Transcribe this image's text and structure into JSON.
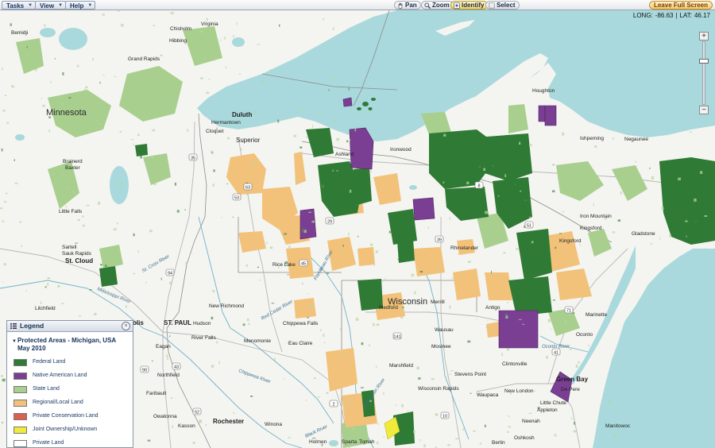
{
  "toolbar": {
    "menus": [
      {
        "label": "Tasks"
      },
      {
        "label": "View"
      },
      {
        "label": "Help"
      }
    ],
    "tools": [
      {
        "label": "Pan",
        "icon": "pan-hand-icon",
        "active": false
      },
      {
        "label": "Zoom",
        "icon": "magnifier-icon",
        "active": false
      },
      {
        "label": "Identify",
        "icon": "identify-icon",
        "active": true
      },
      {
        "label": "Select",
        "icon": "select-box-icon",
        "active": false
      }
    ],
    "leave_full_screen": "Leave Full Screen"
  },
  "coordinates": {
    "long_label": "LONG:",
    "long_value": "-86.63",
    "separator": "|",
    "lat_label": "LAT:",
    "lat_value": "46.17"
  },
  "zoom": {
    "plus": "+",
    "minus": "−",
    "level": 0.7
  },
  "legend": {
    "title": "Legend",
    "close": "×",
    "layer_title": "Protected Areas - Michigan, USA May 2010",
    "items": [
      {
        "label": "Federal Land",
        "color": "#2f7a35"
      },
      {
        "label": "Native American Land",
        "color": "#7a3f93"
      },
      {
        "label": "State Land",
        "color": "#a8cf8e"
      },
      {
        "label": "Regional/Local Land",
        "color": "#f2c27a"
      },
      {
        "label": "Private Conservation Land",
        "color": "#d9604f"
      },
      {
        "label": "Joint Ownership/Unknown",
        "color": "#f0ea3a"
      },
      {
        "label": "Private Land",
        "color": "#ffffff"
      }
    ]
  },
  "map": {
    "water_color": "#a9d9dc",
    "land_color": "#f4f4f0",
    "places": {
      "minnesota": "Minnesota",
      "wisconsin": "Wisconsin",
      "duluth": "Duluth",
      "hermantown": "Hermantown",
      "cloquet": "Cloquet",
      "superior": "Superior",
      "ashland": "Ashland",
      "ironwood": "Ironwood",
      "houghton": "Houghton",
      "ishpeming": "Ishpeming",
      "negaunee": "Negaunee",
      "gladstone": "Gladstone",
      "iron_mountain": "Iron Mountain",
      "kingsford": "Kingsford",
      "kingsford2": "Kingsford",
      "rhinelander": "Rhinelander",
      "rice_lake": "Rice Lake",
      "medford": "Medford",
      "merrill": "Merrill",
      "antigo": "Antigo",
      "marinette": "Marinette",
      "oconto": "Oconto",
      "wausau": "Wausau",
      "mosinee": "Mosinee",
      "marshfield": "Marshfield",
      "stevens_point": "Stevens Point",
      "wisconsin_rapids": "Wisconsin Rapids",
      "clintonville": "Clintonville",
      "new_london": "New London",
      "waupaca": "Waupaca",
      "green_bay": "Green Bay",
      "de_pere": "De Pere",
      "appleton": "Appleton",
      "little_chute": "Little Chute",
      "neenah": "Neenah",
      "oshkosh": "Oshkosh",
      "berlin": "Berlin",
      "manitowoc": "Manitowoc",
      "st_paul": "ST. PAUL",
      "hudson": "Hudson",
      "new_richmond": "New Richmond",
      "river_falls": "River Falls",
      "menomonie": "Menomonie",
      "eau_claire": "Eau Claire",
      "chippewa_falls": "Chippewa Falls",
      "eagan": "Eagan",
      "northfield": "Northfield",
      "faribault": "Faribault",
      "owatonna": "Owatonna",
      "kasson": "Kasson",
      "rochester": "Rochester",
      "winona": "Winona",
      "holmen": "Holmen",
      "sparta": "Sparta",
      "tomah": "Tomah",
      "brainerd": "Brainerd",
      "baxter": "Baxter",
      "little_falls": "Little Falls",
      "sartell": "Sartell",
      "sauk_rapids": "Sauk Rapids",
      "st_cloud": "St. Cloud",
      "litchfield": "Litchfield",
      "minneapolis": "olis",
      "hibbing": "Hibbing",
      "chisholm": "Chisholm",
      "virginia": "Virginia",
      "grand_rapids": "Grand Rapids",
      "bemidji": "Bemidji"
    },
    "rivers": {
      "mississippi": "Mississippi River",
      "chippewa": "Chippewa River",
      "red_cedar": "Red Cedar River",
      "black": "Black River",
      "wisconsin_river": "Wisconsin River",
      "flambeau": "Flambeau River",
      "oconto_river": "Oconto River",
      "st_croix": "St. Croix River"
    },
    "highways": [
      "35",
      "94",
      "53",
      "39",
      "41",
      "43",
      "90",
      "52",
      "2",
      "10",
      "63",
      "29",
      "8",
      "51",
      "45",
      "141",
      "71",
      "2"
    ]
  }
}
